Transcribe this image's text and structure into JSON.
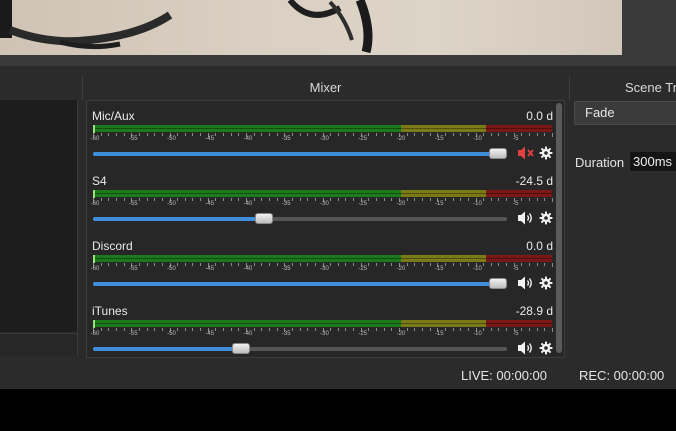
{
  "docks": {
    "mixer_title": "Mixer",
    "transitions_title": "Scene Tr"
  },
  "mixer": {
    "scale_labels": [
      "-60",
      "-55",
      "-50",
      "-45",
      "-40",
      "-35",
      "-30",
      "-25",
      "-20",
      "-15",
      "-10",
      "-5"
    ],
    "channels": [
      {
        "name": "Mic/Aux",
        "db": "0.0 d",
        "volume_fraction": 1.0,
        "muted": true,
        "mute_icon": "speaker-muted-icon"
      },
      {
        "name": "S4",
        "db": "-24.5 d",
        "volume_fraction": 0.41,
        "muted": false,
        "mute_icon": "speaker-icon"
      },
      {
        "name": "Discord",
        "db": "0.0 d",
        "volume_fraction": 1.0,
        "muted": false,
        "mute_icon": "speaker-icon"
      },
      {
        "name": "iTunes",
        "db": "-28.9 d",
        "volume_fraction": 0.35,
        "muted": false,
        "mute_icon": "speaker-icon"
      }
    ],
    "colors": {
      "green": "#1c7a1c",
      "yellow": "#7a7a18",
      "red": "#7a1818",
      "slider_fill": "#3f8edb",
      "muted": "#e04040"
    }
  },
  "transitions": {
    "selected": "Fade",
    "duration_label": "Duration",
    "duration_value": "300ms"
  },
  "status": {
    "live": "LIVE: 00:00:00",
    "rec": "REC: 00:00:00"
  }
}
